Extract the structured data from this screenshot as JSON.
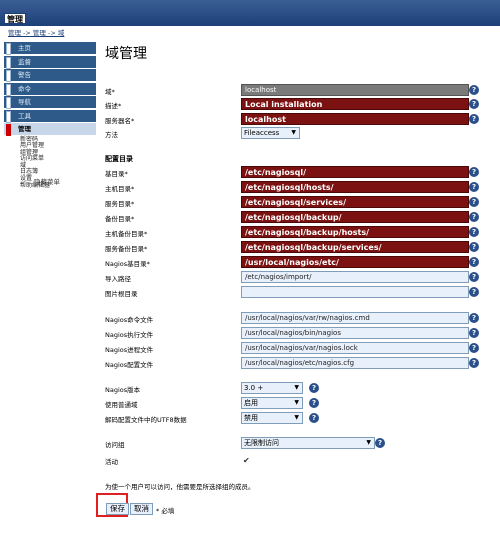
{
  "header": {
    "tab_title": "管理"
  },
  "breadcrumb": {
    "path": "管理 -> 管理 -> 域"
  },
  "sidebar": {
    "items": [
      {
        "label": "主页"
      },
      {
        "label": "监督"
      },
      {
        "label": "警告"
      },
      {
        "label": "命令"
      },
      {
        "label": "导航"
      },
      {
        "label": "工具"
      },
      {
        "label": "管理"
      }
    ],
    "submenu": [
      "新密码",
      "用户管理",
      "组管理",
      "访问菜单",
      "域",
      "日志簿",
      "设置",
      "帮助编辑器"
    ],
    "hide_menu": "隐藏菜单"
  },
  "main": {
    "title": "域管理",
    "fields": {
      "domain": {
        "label": "域*",
        "value": "localhost"
      },
      "description": {
        "label": "描述*",
        "value": "Local installation"
      },
      "server_name": {
        "label": "服务器名*",
        "value": "localhost"
      },
      "method": {
        "label": "方法",
        "value": "Fileaccess"
      }
    },
    "config_section": "配置目录",
    "dirs": [
      {
        "label": "基目录*",
        "value": "/etc/nagiosql/"
      },
      {
        "label": "主机目录*",
        "value": "/etc/nagiosql/hosts/"
      },
      {
        "label": "服务目录*",
        "value": "/etc/nagiosql/services/"
      },
      {
        "label": "备份目录*",
        "value": "/etc/nagiosql/backup/"
      },
      {
        "label": "主机备份目录*",
        "value": "/etc/nagiosql/backup/hosts/"
      },
      {
        "label": "服务备份目录*",
        "value": "/etc/nagiosql/backup/services/"
      },
      {
        "label": "Nagios基目录*",
        "value": "/usr/local/nagios/etc/"
      },
      {
        "label": "导入路径",
        "value": "/etc/nagios/import/"
      },
      {
        "label": "图片根目录",
        "value": ""
      }
    ],
    "files": [
      {
        "label": "Nagios命令文件",
        "value": "/usr/local/nagios/var/rw/nagios.cmd"
      },
      {
        "label": "Nagios执行文件",
        "value": "/usr/local/nagios/bin/nagios"
      },
      {
        "label": "Nagios进程文件",
        "value": "/usr/local/nagios/var/nagios.lock"
      },
      {
        "label": "Nagios配置文件",
        "value": "/usr/local/nagios/etc/nagios.cfg"
      }
    ],
    "options": [
      {
        "label": "Nagios版本",
        "value": "3.0 +"
      },
      {
        "label": "使用普通域",
        "value": "启用"
      },
      {
        "label": "解码配置文件中的UTF8数据",
        "value": "禁用"
      }
    ],
    "access_group": {
      "label": "访问组",
      "value": "无限制访问"
    },
    "active": {
      "label": "活动",
      "checked": true,
      "mark": "✔"
    },
    "note": "为使一个用户可以访问，他需要是所选择组的成员。",
    "save_label": "保存",
    "cancel_label": "取消",
    "required_note": "* 必填",
    "help_glyph": "?"
  },
  "colors": {
    "header": "#1d3f78",
    "required_field": "#7b1111",
    "locked_field": "#7a7a7a",
    "input_bg": "#e8f0fb",
    "highlight": "#e02020"
  }
}
